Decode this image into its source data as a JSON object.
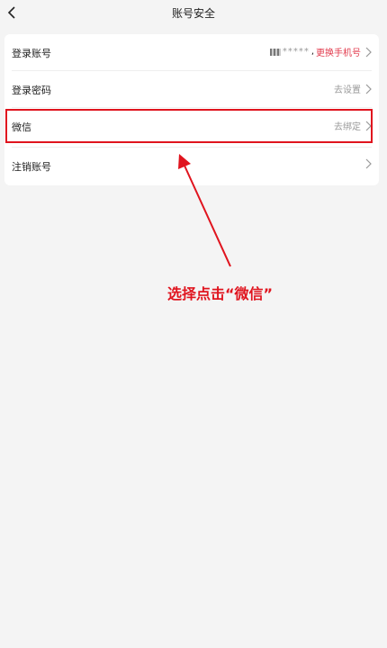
{
  "header": {
    "title": "账号安全"
  },
  "rows": [
    {
      "label": "登录账号",
      "value_masked": "*****",
      "separator": ",",
      "action": "更换手机号"
    },
    {
      "label": "登录密码",
      "value": "去设置"
    },
    {
      "label": "微信",
      "value": "去绑定"
    },
    {
      "label": "注销账号",
      "value": ""
    }
  ],
  "annotation": {
    "text": "选择点击“微信”",
    "color": "#e0141e"
  },
  "colors": {
    "accent_red": "#e23a4c",
    "background": "#f4f4f4",
    "card": "#ffffff",
    "secondary_text": "#999999"
  },
  "icons": {
    "back": "chevron-left-icon",
    "row_arrow": "chevron-right-icon"
  }
}
